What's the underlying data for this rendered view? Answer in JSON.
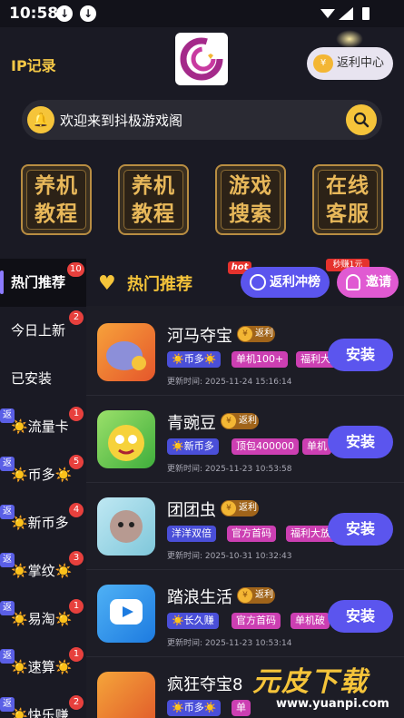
{
  "status_bar": {
    "time": "10:58"
  },
  "header": {
    "ip_record": "IP记录",
    "rebate_center": "返利中心",
    "search_placeholder": "欢迎来到抖极游戏阁"
  },
  "tiles": [
    {
      "line1": "养机",
      "line2": "教程"
    },
    {
      "line1": "养机",
      "line2": "教程"
    },
    {
      "line1": "游戏",
      "line2": "搜索"
    },
    {
      "line1": "在线",
      "line2": "客服"
    }
  ],
  "sidebar": {
    "items": [
      {
        "label": "热门推荐",
        "badge": "10",
        "rebate": ""
      },
      {
        "label": "今日上新",
        "badge": "2",
        "rebate": ""
      },
      {
        "label": "已安装",
        "badge": "",
        "rebate": ""
      },
      {
        "label": "☀️流量卡",
        "badge": "1",
        "rebate": "返"
      },
      {
        "label": "☀️币多☀️",
        "badge": "5",
        "rebate": "返"
      },
      {
        "label": "☀️新币多",
        "badge": "4",
        "rebate": "返"
      },
      {
        "label": "☀️掌纹☀️",
        "badge": "3",
        "rebate": "返"
      },
      {
        "label": "☀️易淘☀️",
        "badge": "1",
        "rebate": "返"
      },
      {
        "label": "☀️速算☀️",
        "badge": "1",
        "rebate": "返"
      },
      {
        "label": "☀️快乐赚",
        "badge": "2",
        "rebate": "返"
      }
    ]
  },
  "main": {
    "section_title": "热门推荐",
    "hot_tag": "hot",
    "rush_button": "返利冲榜",
    "earn_tag": "秒赚1元",
    "invite_button": "邀请",
    "install_label": "安装",
    "rebate_label": "返利",
    "games": [
      {
        "name": "河马夺宝",
        "tags": [
          "☀️币多☀️",
          "单机100+",
          "福利大放送"
        ],
        "update": "更新时间: 2025-11-24 15:16:14"
      },
      {
        "name": "青豌豆",
        "tags": [
          "☀️新币多",
          "顶包400000",
          "单机"
        ],
        "update": "更新时间: 2025-11-23 10:53:58"
      },
      {
        "name": "团团虫",
        "tags": [
          "洋洋双倍",
          "官方首码",
          "福利大放送"
        ],
        "update": "更新时间: 2025-10-31 10:32:43"
      },
      {
        "name": "踏浪生活",
        "tags": [
          "☀️长久赚",
          "官方首码",
          "单机破"
        ],
        "update": "更新时间: 2025-11-23 10:53:14"
      },
      {
        "name": "疯狂夺宝8",
        "tags": [
          "☀️币多☀️",
          "单"
        ],
        "update": ""
      }
    ]
  },
  "watermark": {
    "text": "元皮下载",
    "url": "www.yuanpi.com"
  }
}
